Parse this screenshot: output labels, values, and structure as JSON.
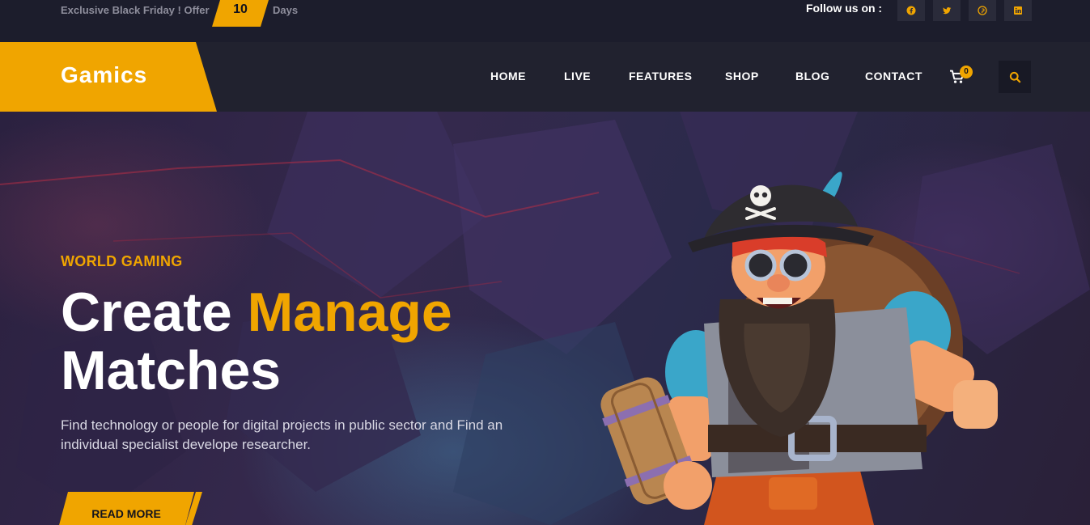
{
  "topbar": {
    "offer_text": "Exclusive Black Friday ! Offer",
    "offer_count": "10",
    "offer_unit": "Days",
    "follow_label": "Follow us on :",
    "social": [
      {
        "icon": "facebook-icon"
      },
      {
        "icon": "twitter-icon"
      },
      {
        "icon": "pinterest-icon"
      },
      {
        "icon": "linkedin-icon"
      }
    ]
  },
  "nav": {
    "logo": "Gamics",
    "items": [
      "HOME",
      "LIVE",
      "FEATURES",
      "SHOP",
      "BLOG",
      "CONTACT"
    ],
    "cart_count": "0",
    "cart_icon": "cart-icon",
    "search_icon": "search-icon"
  },
  "hero": {
    "eyebrow": "WORLD GAMING",
    "title_part1": "Create ",
    "title_accent": "Manage",
    "title_part2": "Matches",
    "description": "Find technology or people for digital projects in public sector and Find an individual specialist develope researcher.",
    "cta": "READ MORE",
    "illustration": "pirate-character-illustration"
  },
  "colors": {
    "accent": "#f0a500",
    "topbar_bg": "#1c1d2c",
    "navbar_bg": "#21222f",
    "text_light": "#ffffff"
  }
}
